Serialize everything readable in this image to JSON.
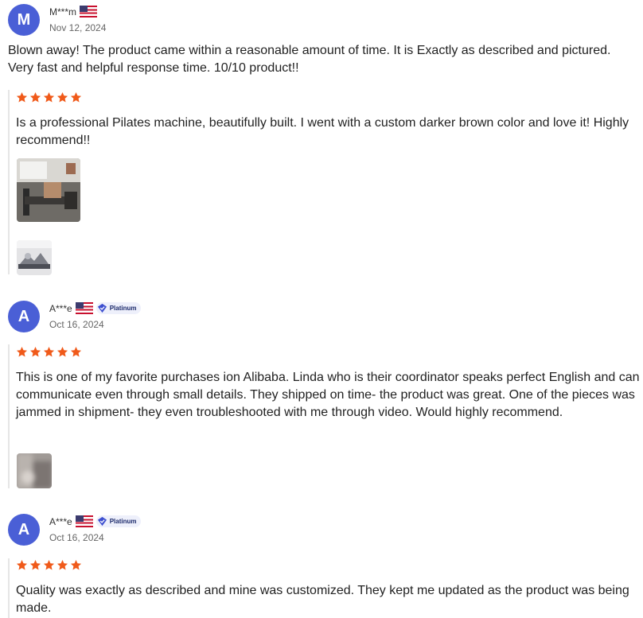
{
  "reviews": [
    {
      "avatar_letter": "M",
      "user": "M***m",
      "date": "Nov 12, 2024",
      "text": "Blown away! The product came within a reasonable amount of time. It is Exactly as described and pictured. Very fast and helpful response time. 10/10 product!!",
      "followup": {
        "rating": 5,
        "text": "Is a professional Pilates machine, beautifully built. I went with a custom darker brown color and love it! Highly recommend!!"
      }
    },
    {
      "avatar_letter": "A",
      "user": "A***e",
      "badge": "Platinum",
      "date": "Oct 16, 2024",
      "rating": 5,
      "text": "This is one of my favorite purchases ion Alibaba. Linda who is their coordinator speaks perfect English and can communicate even through small details. They shipped on time- the product was great. One of the pieces was jammed in shipment- they even troubleshooted with me through video. Would highly recommend."
    },
    {
      "avatar_letter": "A",
      "user": "A***e",
      "badge": "Platinum",
      "date": "Oct 16, 2024",
      "rating": 5,
      "text": "Quality was exactly as described and mine was customized. They kept me updated as the product was being made."
    }
  ],
  "colors": {
    "avatar": "#4a5fd6",
    "star": "#f05a1a",
    "badge_bg": "#eef0fb"
  }
}
